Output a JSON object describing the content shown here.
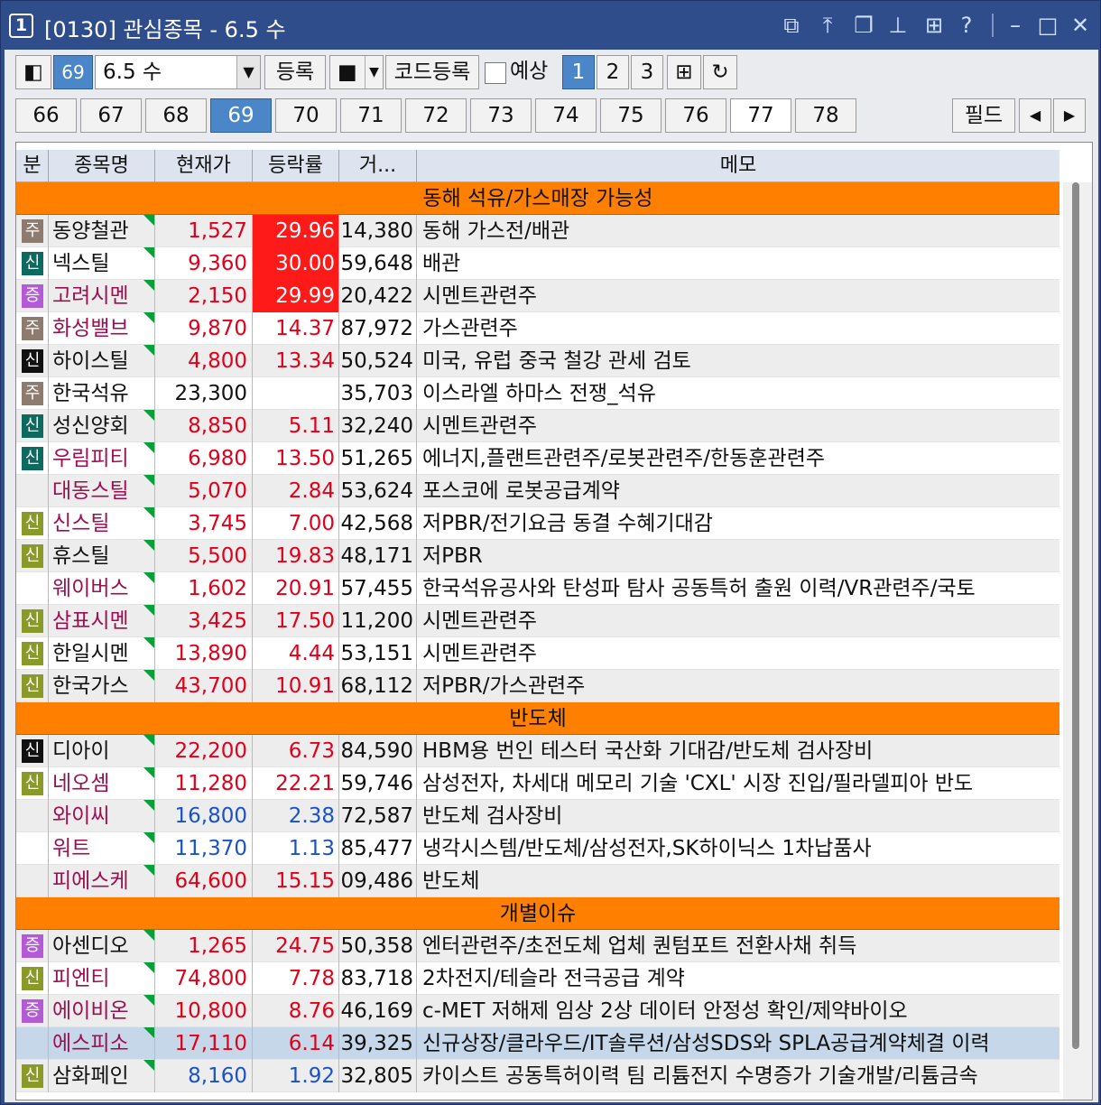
{
  "window": {
    "number": "1",
    "title": "[0130] 관심종목 - 6.5 수",
    "icons": [
      "restore-down-icon",
      "upload-icon",
      "copy-window-icon",
      "pin-icon",
      "grid-icon",
      "help-icon",
      "minimize-icon",
      "maximize-icon",
      "close-icon"
    ],
    "help_glyph": "?"
  },
  "toolbar": {
    "group_number": "69",
    "group_name": "6.5 수",
    "register_label": "등록",
    "stop_glyph": "■",
    "code_register_label": "코드등록",
    "forecast_label": "예상",
    "pages": [
      "1",
      "2",
      "3"
    ],
    "active_page": "1"
  },
  "group_tabs": {
    "tabs": [
      "66",
      "67",
      "68",
      "69",
      "70",
      "71",
      "72",
      "73",
      "74",
      "75",
      "76",
      "77",
      "78"
    ],
    "active": "69",
    "field_label": "필드",
    "prev_glyph": "◀",
    "next_glyph": "▶"
  },
  "columns": [
    "분",
    "종목명",
    "현재가",
    "등락률",
    "거...",
    "메모"
  ],
  "colors": {
    "accent": "#2e4d8a",
    "group_header": "#ff8000",
    "up": "#e0001a",
    "down": "#1b52c8",
    "hot": "#ff1a1a"
  },
  "groups": [
    {
      "title": "동해 석유/가스매장 가능성",
      "rows": [
        {
          "badge": "주",
          "badge_color": "#8c7b6e",
          "name": "동양철관",
          "name_color": "#111",
          "tri": true,
          "price": "1,527",
          "rate": "29.96",
          "dir": "up",
          "hot": true,
          "vol": "14,380",
          "memo": "동해 가스전/배관"
        },
        {
          "badge": "신",
          "badge_color": "#0e6a5e",
          "name": "넥스틸",
          "name_color": "#111",
          "tri": true,
          "price": "9,360",
          "rate": "30.00",
          "dir": "up",
          "hot": true,
          "vol": "59,648",
          "memo": "배관"
        },
        {
          "badge": "증",
          "badge_color": "#b35bd6",
          "name": "고려시멘",
          "name_color": "#9b1050",
          "tri": true,
          "price": "2,150",
          "rate": "29.99",
          "dir": "up",
          "hot": true,
          "vol": "20,422",
          "memo": "시멘트관련주"
        },
        {
          "badge": "주",
          "badge_color": "#8c7b6e",
          "name": "화성밸브",
          "name_color": "#9b1050",
          "tri": true,
          "price": "9,870",
          "rate": "14.37",
          "dir": "up",
          "hot": false,
          "vol": "87,972",
          "memo": "가스관련주"
        },
        {
          "badge": "신",
          "badge_color": "#111111",
          "name": "하이스틸",
          "name_color": "#111",
          "tri": true,
          "price": "4,800",
          "rate": "13.34",
          "dir": "up",
          "hot": false,
          "vol": "50,524",
          "memo": "미국, 유럽 중국 철강 관세 검토"
        },
        {
          "badge": "주",
          "badge_color": "#8c7b6e",
          "name": "한국석유",
          "name_color": "#111",
          "tri": false,
          "price": "23,300",
          "rate": "",
          "dir": "neu",
          "hot": false,
          "vol": "35,703",
          "memo": "이스라엘 하마스 전쟁_석유"
        },
        {
          "badge": "신",
          "badge_color": "#0e6a5e",
          "name": "성신양회",
          "name_color": "#111",
          "tri": true,
          "price": "8,850",
          "rate": "5.11",
          "dir": "up",
          "hot": false,
          "vol": "32,240",
          "memo": "시멘트관련주"
        },
        {
          "badge": "신",
          "badge_color": "#0e6a5e",
          "name": "우림피티",
          "name_color": "#9b1050",
          "tri": true,
          "price": "6,980",
          "rate": "13.50",
          "dir": "up",
          "hot": false,
          "vol": "51,265",
          "memo": "에너지,플랜트관련주/로봇관련주/한동훈관련주"
        },
        {
          "badge": "",
          "badge_color": "",
          "name": "대동스틸",
          "name_color": "#9b1050",
          "tri": true,
          "price": "5,070",
          "rate": "2.84",
          "dir": "up",
          "hot": false,
          "vol": "53,624",
          "memo": "포스코에 로봇공급계약"
        },
        {
          "badge": "신",
          "badge_color": "#8a9a2a",
          "name": "신스틸",
          "name_color": "#9b1050",
          "tri": true,
          "price": "3,745",
          "rate": "7.00",
          "dir": "up",
          "hot": false,
          "vol": "42,568",
          "memo": "저PBR/전기요금 동결 수혜기대감"
        },
        {
          "badge": "신",
          "badge_color": "#8a9a2a",
          "name": "휴스틸",
          "name_color": "#111",
          "tri": true,
          "price": "5,500",
          "rate": "19.83",
          "dir": "up",
          "hot": false,
          "vol": "48,171",
          "memo": "저PBR"
        },
        {
          "badge": "",
          "badge_color": "",
          "name": "웨이버스",
          "name_color": "#9b1050",
          "tri": true,
          "price": "1,602",
          "rate": "20.91",
          "dir": "up",
          "hot": false,
          "vol": "57,455",
          "memo": " 한국석유공사와 탄성파 탐사 공동특허 출원 이력/VR관련주/국토"
        },
        {
          "badge": "신",
          "badge_color": "#8a9a2a",
          "name": "삼표시멘",
          "name_color": "#9b1050",
          "tri": true,
          "price": "3,425",
          "rate": "17.50",
          "dir": "up",
          "hot": false,
          "vol": "11,200",
          "memo": "시멘트관련주"
        },
        {
          "badge": "신",
          "badge_color": "#8a9a2a",
          "name": "한일시멘",
          "name_color": "#111",
          "tri": true,
          "price": "13,890",
          "rate": "4.44",
          "dir": "up",
          "hot": false,
          "vol": "53,151",
          "memo": "시멘트관련주"
        },
        {
          "badge": "신",
          "badge_color": "#8a9a2a",
          "name": "한국가스",
          "name_color": "#111",
          "tri": true,
          "price": "43,700",
          "rate": "10.91",
          "dir": "up",
          "hot": false,
          "vol": "68,112",
          "memo": "저PBR/가스관련주"
        }
      ]
    },
    {
      "title": "반도체",
      "rows": [
        {
          "badge": "신",
          "badge_color": "#111111",
          "name": "디아이",
          "name_color": "#111",
          "tri": true,
          "price": "22,200",
          "rate": "6.73",
          "dir": "up",
          "hot": false,
          "vol": "84,590",
          "memo": "HBM용 번인 테스터 국산화 기대감/반도체 검사장비"
        },
        {
          "badge": "신",
          "badge_color": "#8a9a2a",
          "name": "네오셈",
          "name_color": "#9b1050",
          "tri": true,
          "price": "11,280",
          "rate": "22.21",
          "dir": "up",
          "hot": false,
          "vol": "59,746",
          "memo": "삼성전자, 차세대 메모리 기술 'CXL' 시장 진입/필라델피아 반도"
        },
        {
          "badge": "",
          "badge_color": "",
          "name": "와이씨",
          "name_color": "#9b1050",
          "tri": true,
          "price": "16,800",
          "rate": "2.38",
          "dir": "dn",
          "hot": false,
          "vol": "72,587",
          "memo": "반도체 검사장비"
        },
        {
          "badge": "",
          "badge_color": "",
          "name": "워트",
          "name_color": "#9b1050",
          "tri": true,
          "price": "11,370",
          "rate": "1.13",
          "dir": "dn",
          "hot": false,
          "vol": "85,477",
          "memo": "냉각시스템/반도체/삼성전자,SK하이닉스 1차납품사"
        },
        {
          "badge": "",
          "badge_color": "",
          "name": "피에스케",
          "name_color": "#9b1050",
          "tri": true,
          "price": "64,600",
          "rate": "15.15",
          "dir": "up",
          "hot": false,
          "vol": "09,486",
          "memo": "반도체"
        }
      ]
    },
    {
      "title": "개별이슈",
      "rows": [
        {
          "badge": "증",
          "badge_color": "#b35bd6",
          "name": "아센디오",
          "name_color": "#111",
          "tri": true,
          "price": "1,265",
          "rate": "24.75",
          "dir": "up",
          "hot": false,
          "vol": "50,358",
          "memo": "엔터관련주/초전도체 업체 퀀텀포트 전환사채 취득"
        },
        {
          "badge": "신",
          "badge_color": "#8a9a2a",
          "name": "피엔티",
          "name_color": "#9b1050",
          "tri": true,
          "price": "74,800",
          "rate": "7.78",
          "dir": "up",
          "hot": false,
          "vol": "83,718",
          "memo": "2차전지/테슬라 전극공급 계약"
        },
        {
          "badge": "증",
          "badge_color": "#b35bd6",
          "name": "에이비온",
          "name_color": "#9b1050",
          "tri": true,
          "price": "10,800",
          "rate": "8.76",
          "dir": "up",
          "hot": false,
          "vol": "46,169",
          "memo": "c-MET 저해제 임상 2상 데이터 안정성 확인/제약바이오"
        },
        {
          "badge": "",
          "badge_color": "",
          "name": "에스피소",
          "name_color": "#9b1050",
          "tri": true,
          "price": "17,110",
          "rate": "6.14",
          "dir": "up",
          "hot": false,
          "vol": "39,325",
          "memo": "신규상장/클라우드/IT솔루션/삼성SDS와 SPLA공급계약체결 이력",
          "highlight": true
        },
        {
          "badge": "신",
          "badge_color": "#8a9a2a",
          "name": "삼화페인",
          "name_color": "#111",
          "tri": true,
          "price": "8,160",
          "rate": "1.92",
          "dir": "dn",
          "hot": false,
          "vol": "32,805",
          "memo": "카이스트 공동특허이력 팀 리튬전지 수명증가 기술개발/리튬금속"
        }
      ]
    }
  ]
}
